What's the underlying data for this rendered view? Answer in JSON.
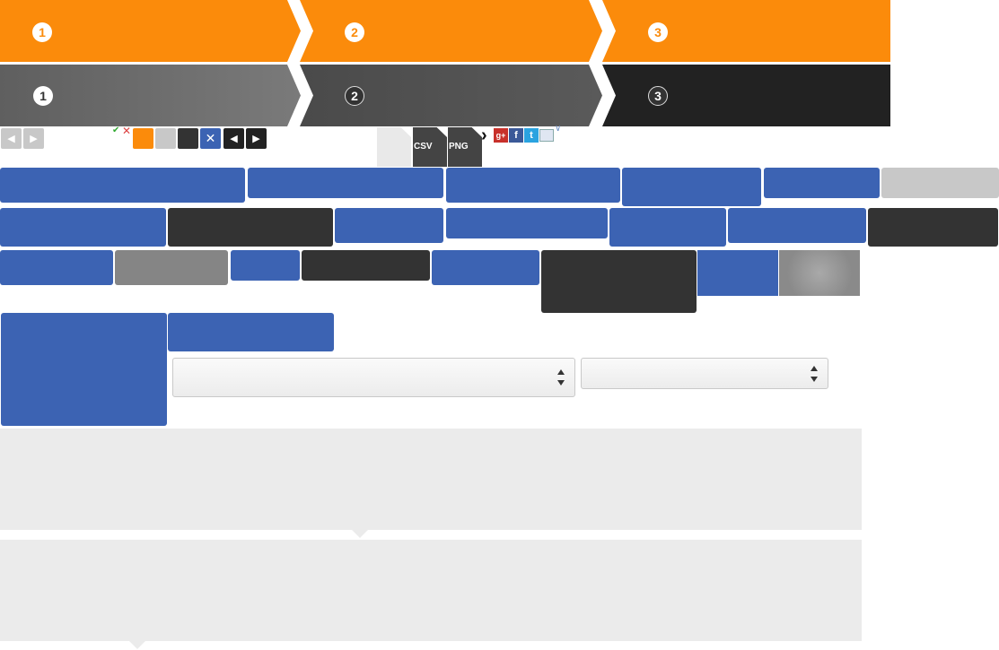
{
  "wizard_orange": {
    "steps": [
      {
        "number": "1"
      },
      {
        "number": "2"
      },
      {
        "number": "3"
      }
    ],
    "color": "#fb8b0b"
  },
  "wizard_grey": {
    "steps": [
      {
        "number": "1"
      },
      {
        "number": "2"
      },
      {
        "number": "3"
      }
    ],
    "colors": [
      "#6b6b6b",
      "#4f4f4f",
      "#222222"
    ]
  },
  "toolbar": {
    "prev_icon": "chevron-left-icon",
    "next_icon": "chevron-right-icon",
    "check_icon": "check-icon",
    "cross_icon": "cross-icon",
    "swatches": [
      "#fb8b0b",
      "#c8c8c8",
      "#333333"
    ],
    "close_icon": "close-icon"
  },
  "exports": {
    "csv_label": "CSV",
    "png_label": "PNG"
  },
  "share": {
    "gplus": "g+",
    "facebook": "f",
    "twitter": "t",
    "email": "email-icon"
  },
  "colors": {
    "blue": "#3c63b3",
    "dark": "#333333",
    "panel": "#ebebeb"
  }
}
